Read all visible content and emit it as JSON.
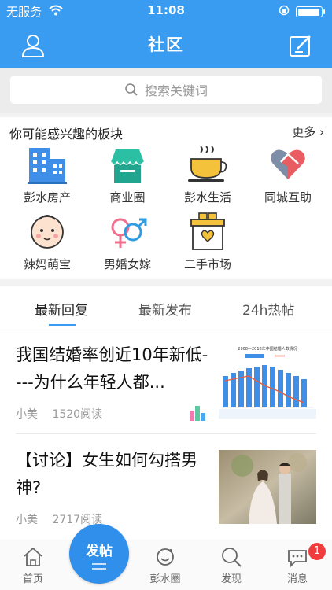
{
  "status_bar": {
    "carrier": "无服务",
    "time": "11:08",
    "battery_percent": 95
  },
  "header": {
    "title": "社区",
    "profile_icon": "user-icon",
    "compose_icon": "edit-icon"
  },
  "search": {
    "placeholder": "搜索关键词"
  },
  "boards": {
    "title": "你可能感兴趣的板块",
    "more": "更多 ›",
    "items": [
      {
        "label": "彭水房产",
        "icon": "building-icon"
      },
      {
        "label": "商业圈",
        "icon": "shop-icon"
      },
      {
        "label": "彭水生活",
        "icon": "teacup-icon"
      },
      {
        "label": "同城互助",
        "icon": "heart-handshake-icon"
      },
      {
        "label": "辣妈萌宝",
        "icon": "baby-icon"
      },
      {
        "label": "男婚女嫁",
        "icon": "gender-icon"
      },
      {
        "label": "二手市场",
        "icon": "box-icon"
      }
    ]
  },
  "tabs": [
    {
      "label": "最新回复"
    },
    {
      "label": "最新发布"
    },
    {
      "label": "24h热帖"
    }
  ],
  "posts": [
    {
      "title": "我国结婚率创近10年新低----为什么年轻人都...",
      "author": "小美",
      "reads": "1520阅读",
      "thumb_title": "2008—2018年中国结婚人数情况"
    },
    {
      "title": "【讨论】女生如何勾搭男神?",
      "author": "小美",
      "reads": "2717阅读"
    }
  ],
  "tabbar": {
    "items": [
      {
        "label": "首页",
        "icon": "home-icon"
      },
      {
        "label": "彭水圈",
        "icon": "circle-icon"
      },
      {
        "label": "发现",
        "icon": "discover-icon"
      },
      {
        "label": "消息",
        "icon": "message-icon"
      }
    ],
    "post_button": "发帖",
    "message_badge": "1"
  },
  "colors": {
    "primary": "#3a9cf0",
    "badge": "#f03c3c"
  }
}
